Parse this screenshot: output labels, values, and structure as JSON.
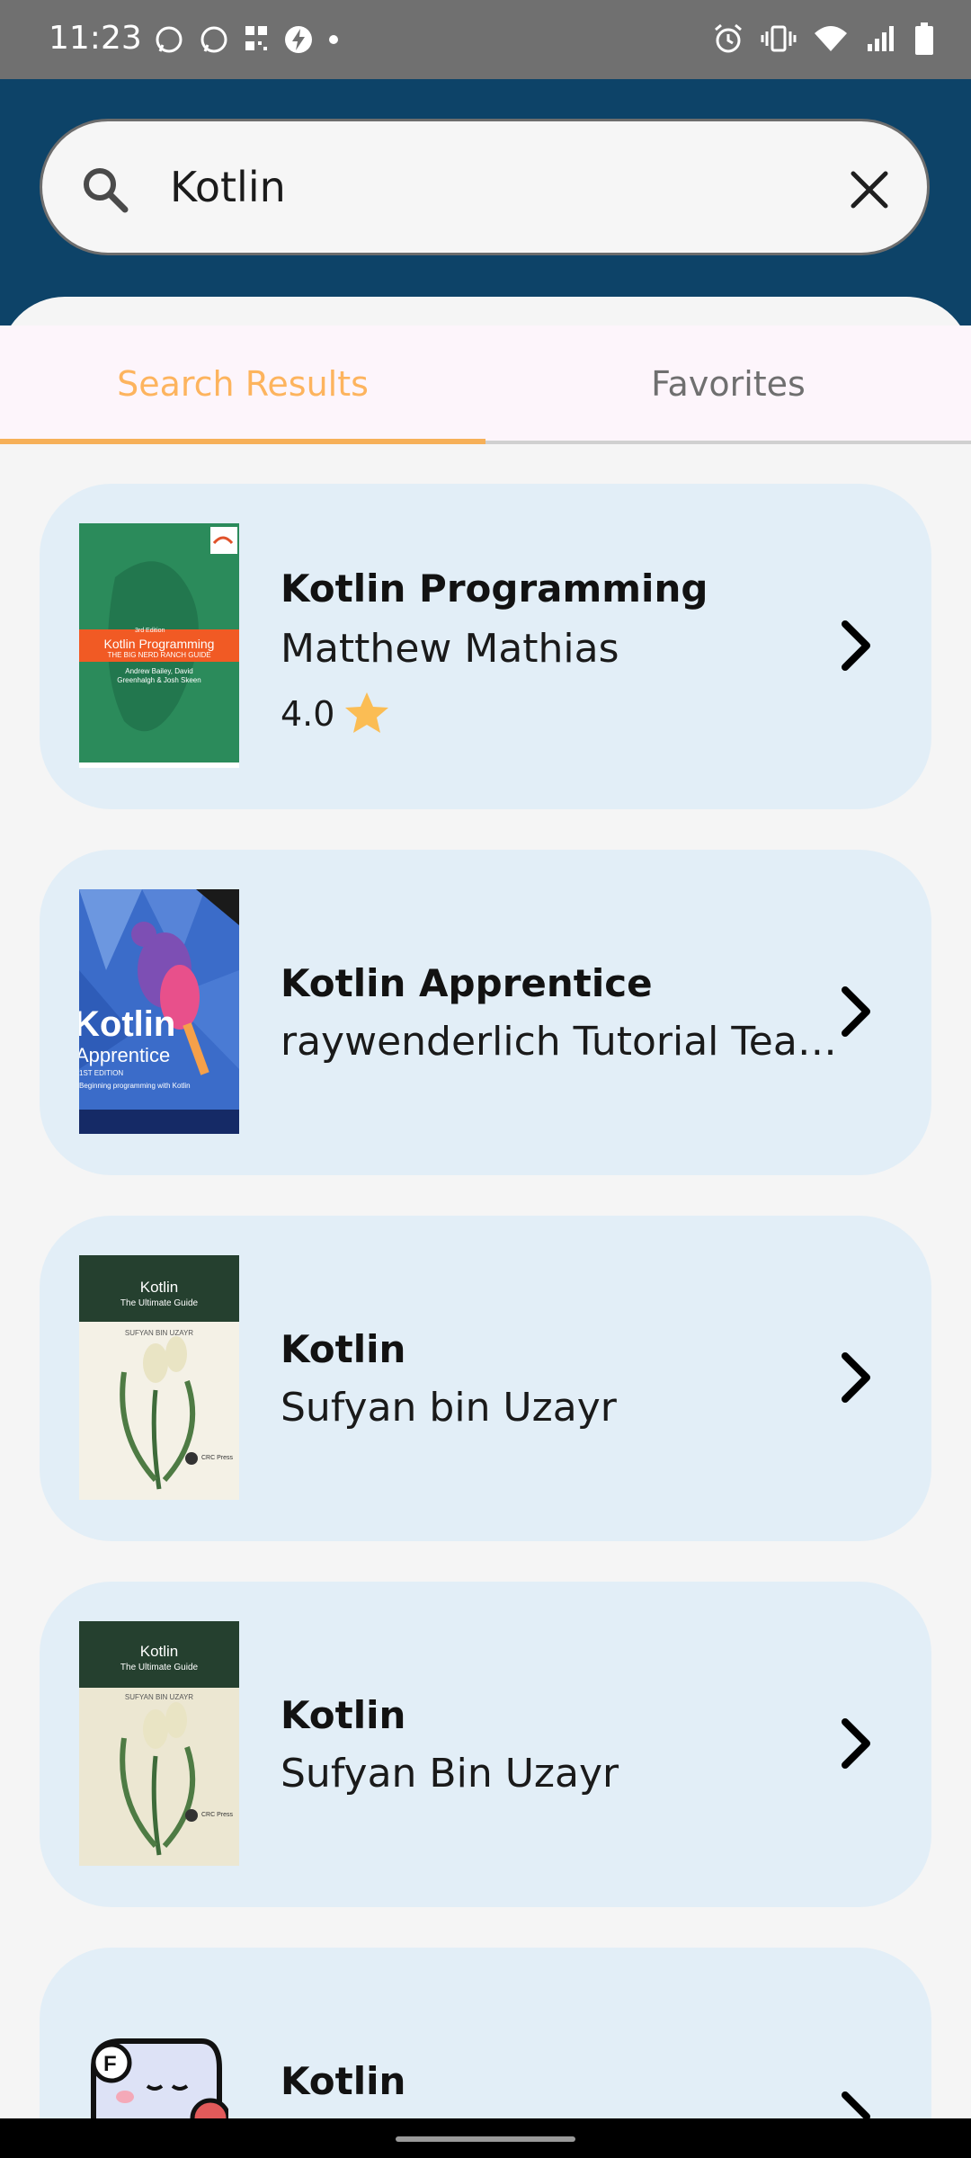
{
  "status_bar": {
    "time": "11:23"
  },
  "search": {
    "query": "Kotlin"
  },
  "tabs": [
    {
      "label": "Search Results"
    },
    {
      "label": "Favorites"
    }
  ],
  "results": [
    {
      "title": "Kotlin Programming",
      "author": "Matthew Mathias",
      "rating": "4.0",
      "cover_text": {
        "edition": "3rd Edition",
        "title": "Kotlin Programming",
        "subtitle": "THE BIG NERD RANCH GUIDE",
        "authors": "Andrew Bailey, David Greenhalgh & Josh Skeen"
      }
    },
    {
      "title": "Kotlin Apprentice",
      "author": "raywenderlich Tutorial Tea…",
      "cover_text": {
        "title": "Kotlin",
        "subtitle": "Apprentice",
        "edition": "1ST EDITION",
        "tagline": "Beginning programming with Kotlin"
      }
    },
    {
      "title": "Kotlin",
      "author": "Sufyan bin Uzayr",
      "cover_text": {
        "title": "Kotlin",
        "subtitle": "The Ultimate Guide",
        "author": "SUFYAN BIN UZAYR",
        "publisher": "CRC Press"
      }
    },
    {
      "title": "Kotlin",
      "author": "Sufyan Bin Uzayr",
      "cover_text": {
        "title": "Kotlin",
        "subtitle": "The Ultimate Guide",
        "author": "SUFYAN BIN UZAYR",
        "publisher": "CRC Press"
      }
    },
    {
      "title": "Kotlin",
      "author": ""
    }
  ],
  "colors": {
    "appbar": "#0D4368",
    "accent": "#F6B058",
    "card": "#E2EEF7"
  }
}
